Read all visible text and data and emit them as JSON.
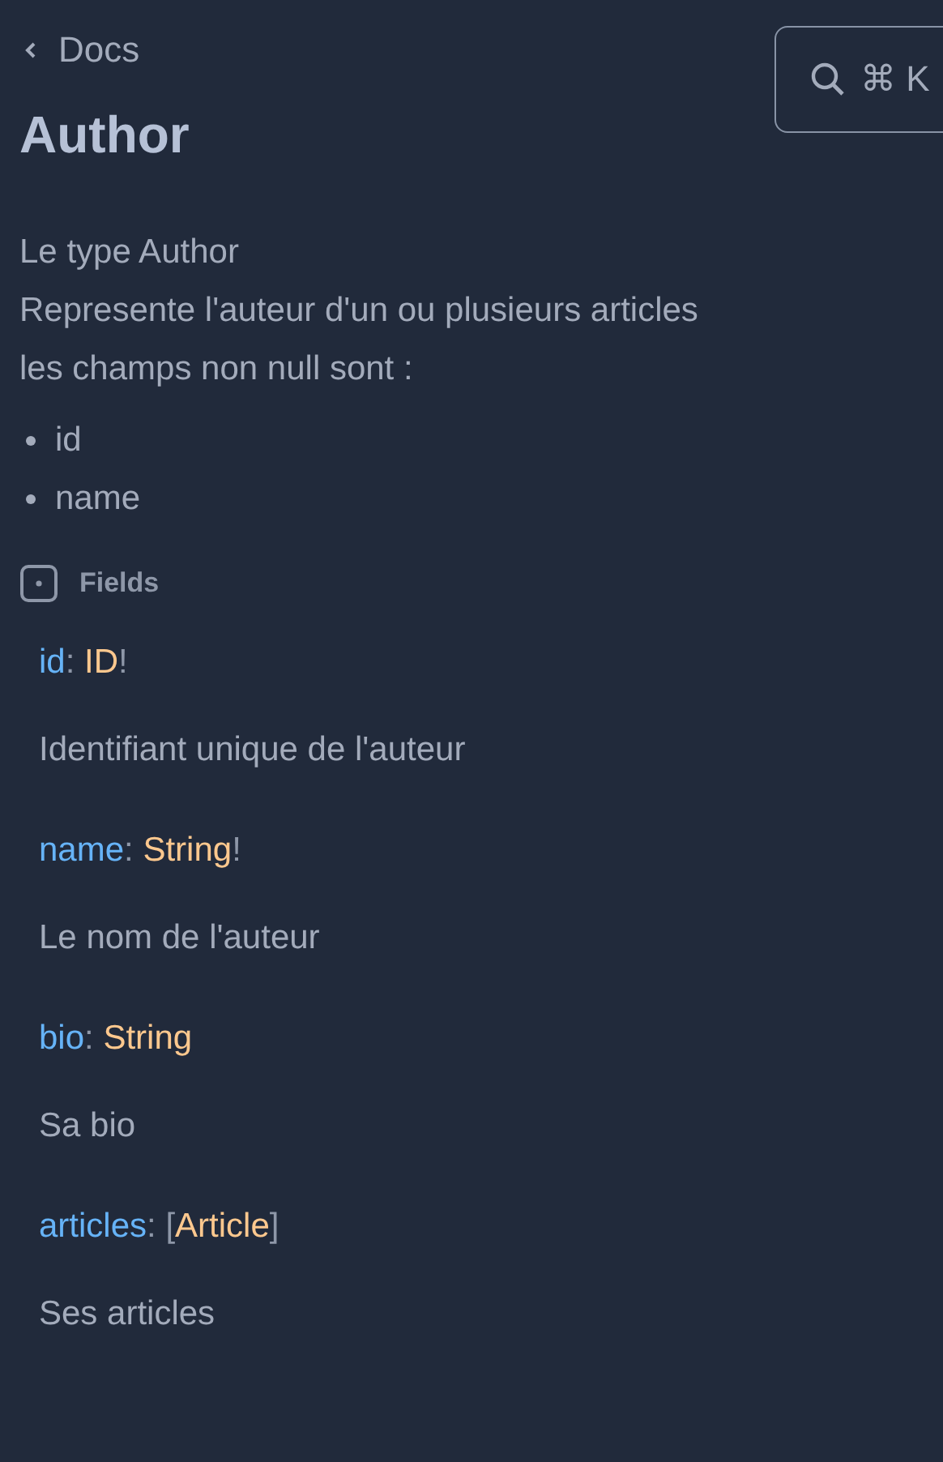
{
  "back_link": {
    "label": "Docs"
  },
  "search_button": {
    "shortcut": "⌘ K"
  },
  "title": "Author",
  "description": [
    "Le type Author",
    "Represente l'auteur d'un ou plusieurs articles",
    "les champs non null sont :"
  ],
  "bullets": [
    "id",
    "name"
  ],
  "fields_heading": "Fields",
  "fields": [
    {
      "name": "id",
      "colon": ":",
      "type": "ID",
      "close": "!",
      "description": "Identifiant unique de l'auteur"
    },
    {
      "name": "name",
      "colon": ":",
      "type": "String",
      "close": "!",
      "description": "Le nom de l'auteur"
    },
    {
      "name": "bio",
      "colon": ":",
      "type": "String",
      "description": "Sa bio"
    },
    {
      "name": "articles",
      "colon": ":",
      "open": "[",
      "type": "Article",
      "close": "]",
      "description": "Ses articles"
    }
  ]
}
